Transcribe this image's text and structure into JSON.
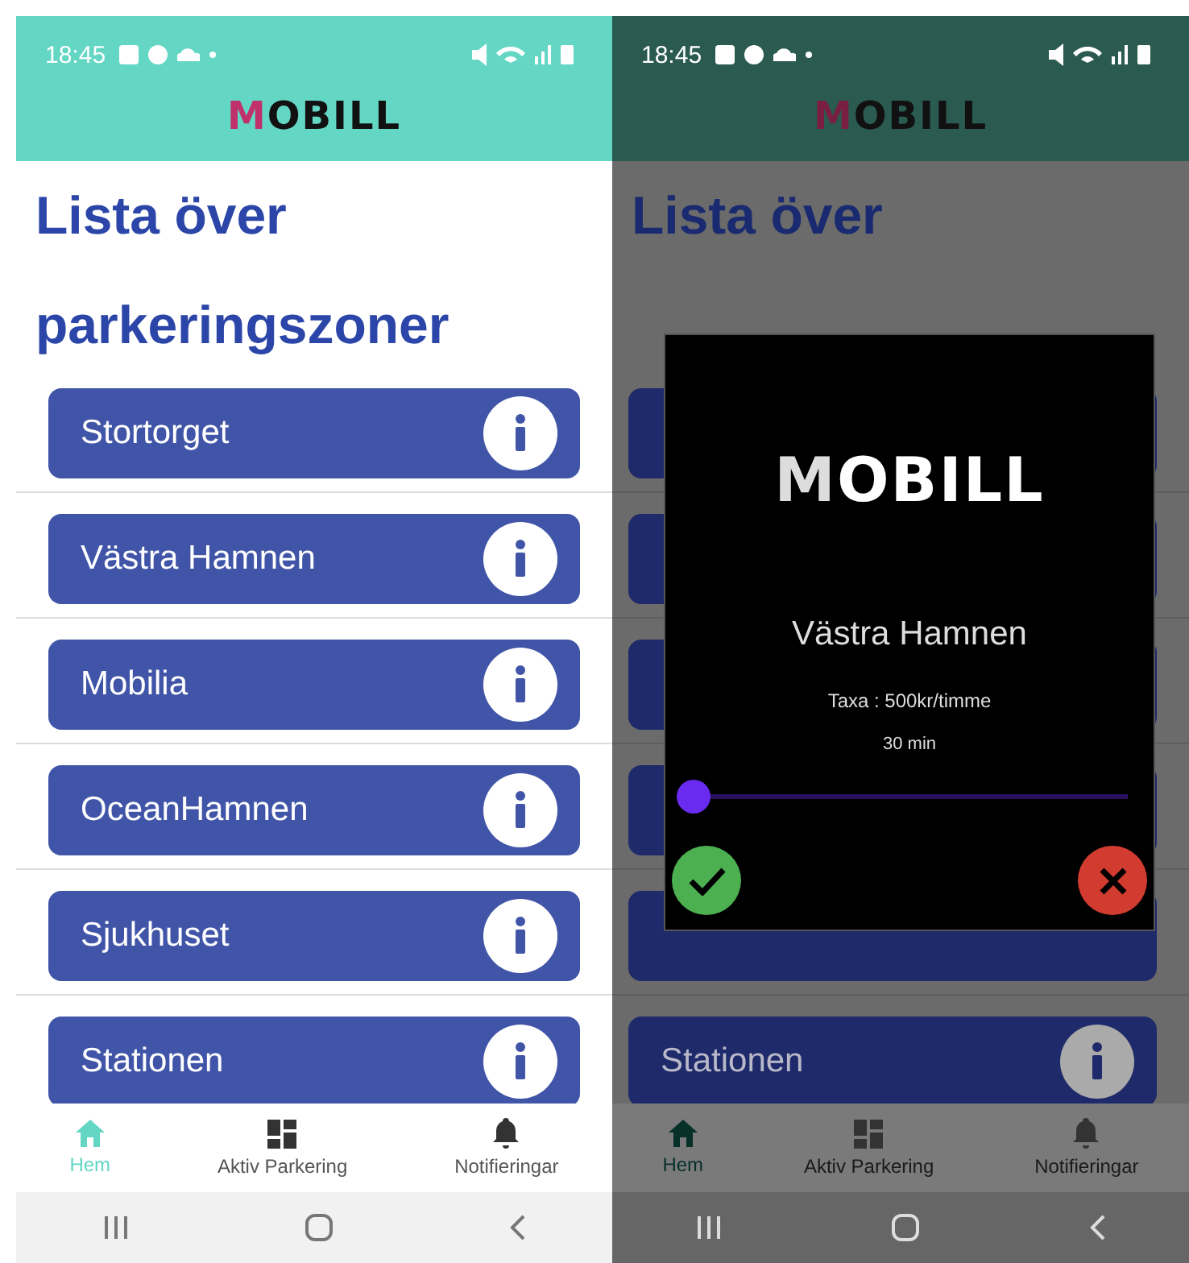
{
  "screens": [
    {
      "status_bar": {
        "time": "18:45"
      },
      "header": {
        "logo": "MOBILL"
      },
      "title": [
        "Lista över",
        "parkeringszoner"
      ],
      "zones": [
        {
          "kind": "labeled",
          "label": "Stortorget"
        },
        {
          "kind": "labeled",
          "label": "Västra Hamnen"
        },
        {
          "kind": "labeled",
          "label": "Mobilia"
        },
        {
          "kind": "labeled",
          "label": "OceanHamnen"
        },
        {
          "kind": "labeled",
          "label": "Sjukhuset"
        },
        {
          "kind": "labeled",
          "label": "Stationen"
        }
      ],
      "bottom_nav": [
        {
          "label": "Hem",
          "selected": true
        },
        {
          "label": "Aktiv Parkering",
          "selected": false
        },
        {
          "label": "Notifieringar",
          "selected": false
        }
      ]
    },
    {
      "status_bar": {
        "time": "18:45"
      },
      "header": {
        "logo": "MOBILL"
      },
      "title": [
        "Lista över"
      ],
      "zones": [
        {
          "kind": "covered"
        },
        {
          "kind": "covered"
        },
        {
          "kind": "covered"
        },
        {
          "kind": "covered"
        },
        {
          "kind": "covered"
        },
        {
          "kind": "labeled",
          "label": "Stationen"
        }
      ],
      "bottom_nav": [
        {
          "label": "Hem",
          "selected": true
        },
        {
          "label": "Aktiv Parkering",
          "selected": false
        },
        {
          "label": "Notifieringar",
          "selected": false
        }
      ],
      "dialog": {
        "logo": "MOBILL",
        "zone": "Västra Hamnen",
        "rate": "Taxa : 500kr/timme",
        "duration": "30 min",
        "slider": {
          "level": 0
        }
      }
    }
  ]
}
